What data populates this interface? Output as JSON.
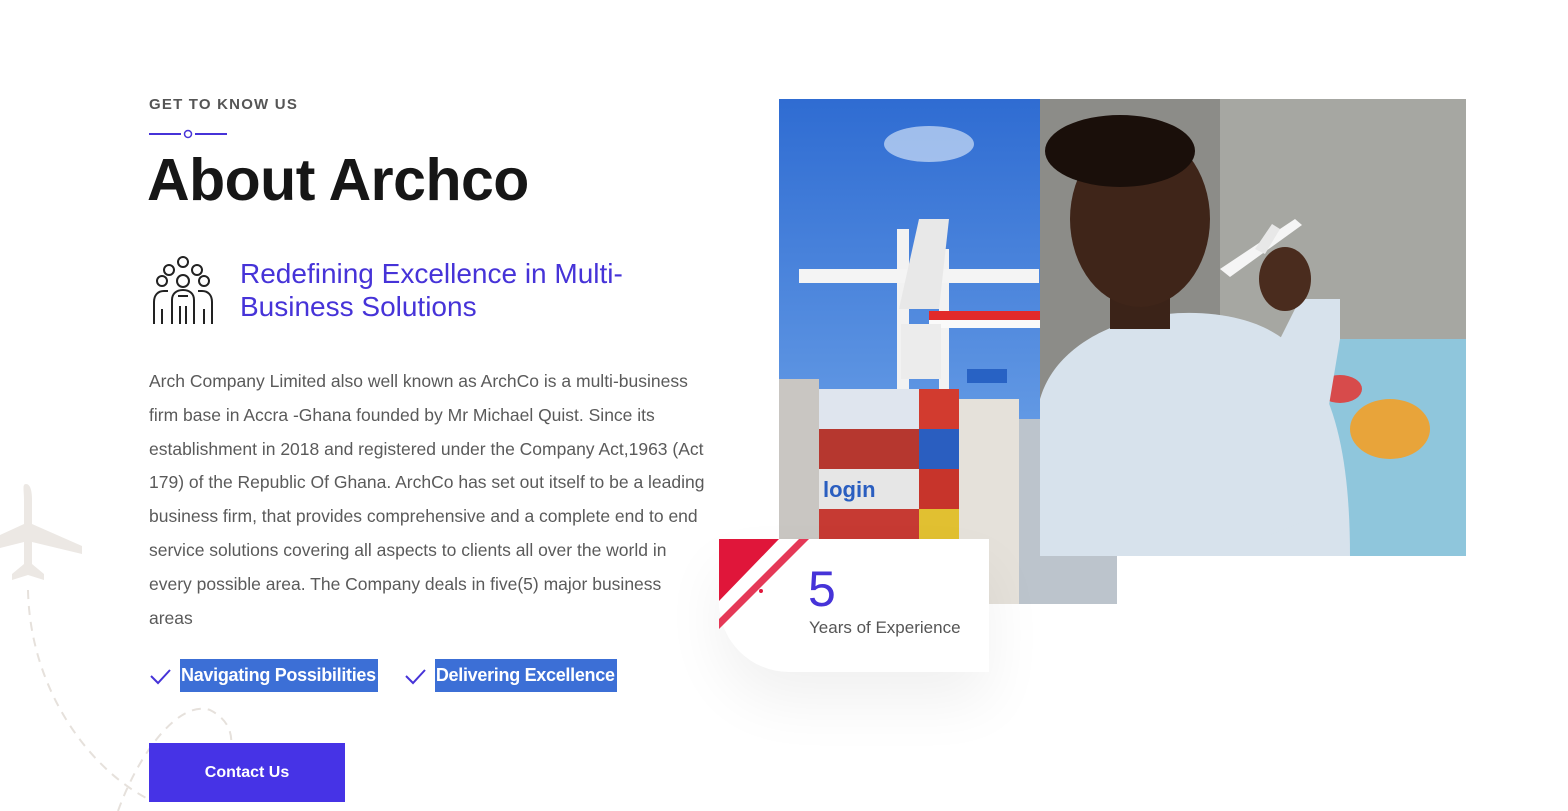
{
  "about": {
    "eyebrow": "GET TO KNOW US",
    "title": "About Archco",
    "feature_icon": "team-group-icon",
    "feature_title": "Redefining Excellence in Multi-Business Solutions",
    "description": "Arch Company Limited also well known as ArchCo is a multi-business firm base in Accra -Ghana founded by Mr Michael Quist. Since its establishment in 2018 and registered under the Company Act,1963 (Act 179) of the Republic Of Ghana. ArchCo has set out itself to be a leading business firm, that provides comprehensive and a complete end to end service solutions covering all aspects to clients all over the world in every possible area. The Company deals in five(5) major business areas",
    "checks": [
      {
        "icon": "checkmark-icon",
        "label": "Navigating Possibilities"
      },
      {
        "icon": "checkmark-icon",
        "label": "Delivering Excellence"
      }
    ],
    "cta_label": "Contact Us"
  },
  "experience": {
    "number": "5",
    "label": "Years of Experience"
  },
  "images": {
    "port": {
      "icon": "port-containers-photo"
    },
    "man": {
      "icon": "man-with-toy-plane-photo"
    }
  },
  "colors": {
    "accent": "#4633d8",
    "button": "#4633e6",
    "highlight": "#3c6fd6",
    "stripe": "#e0163a"
  }
}
